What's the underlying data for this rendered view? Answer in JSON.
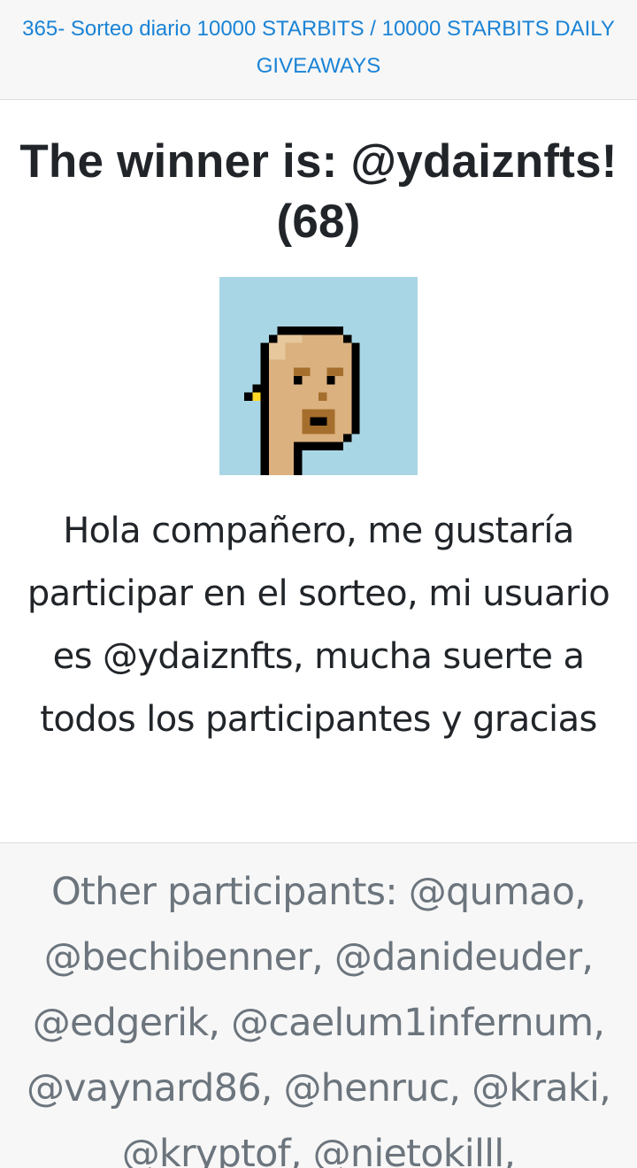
{
  "header": {
    "link_text": "365- Sorteo diario 10000 STARBITS / 10000 STARBITS DAILY GIVEAWAYS"
  },
  "main": {
    "winner_title": "The winner is: @ydaiznfts! (68)",
    "avatar_icon": "pixel-punk-avatar-icon",
    "message": "Hola compañero, me gustaría participar en el sorteo, mi usuario es @ydaiznfts, mucha suerte a todos los participantes y gracias"
  },
  "footer": {
    "participants": "Other participants: @qumao, @bechibenner, @danideuder, @edgerik, @caelum1infernum, @vaynard86, @henruc, @kraki, @kryptof, @nietokilll,"
  },
  "colors": {
    "link": "#1a83d6",
    "title": "#212529",
    "muted": "#6c757d",
    "avatar_bg": "#a9d6e5"
  }
}
